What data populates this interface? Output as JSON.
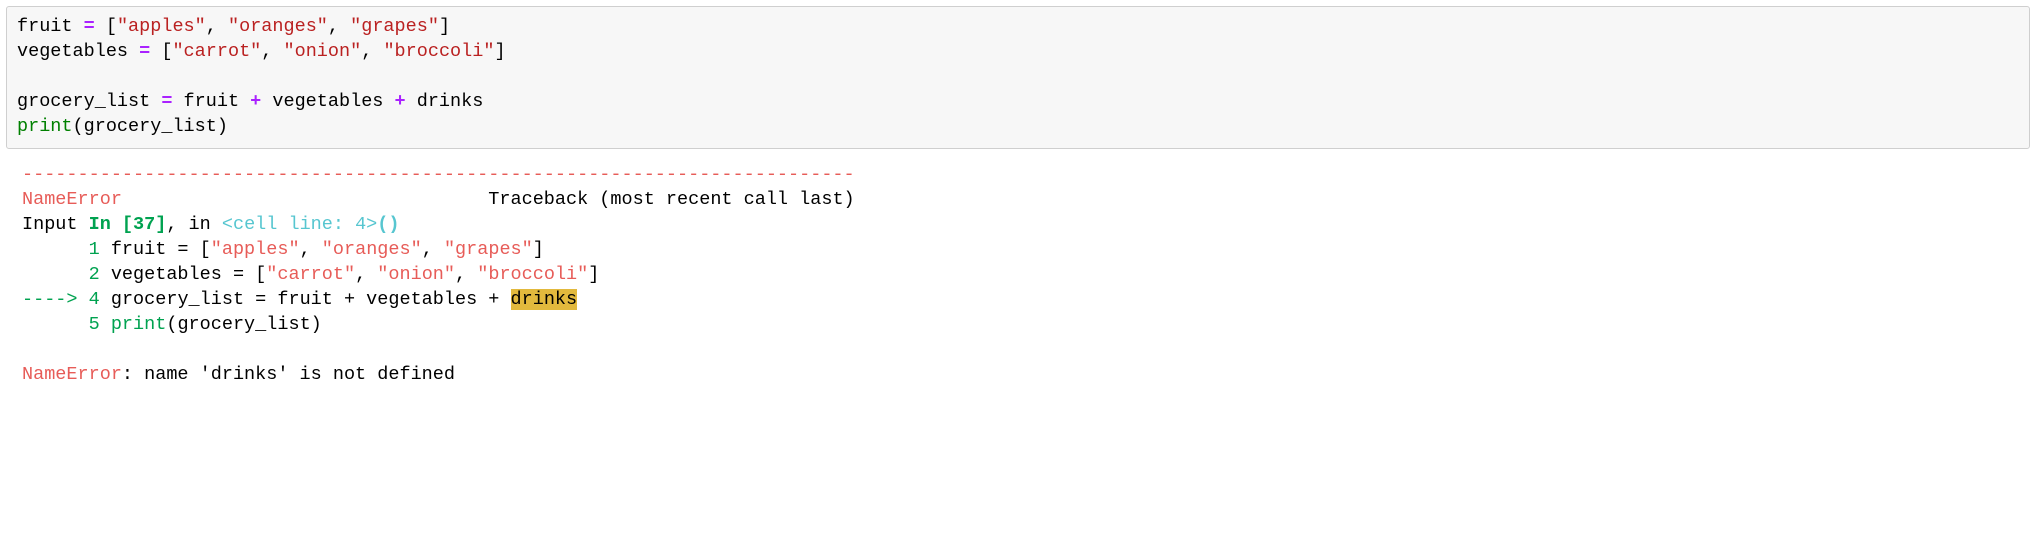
{
  "code": {
    "var_fruit": "fruit",
    "var_vegetables": "vegetables",
    "var_grocery": "grocery_list",
    "var_drinks": "drinks",
    "assign": " = ",
    "plus": " + ",
    "lb": "[",
    "rb": "]",
    "cs": ", ",
    "lp": "(",
    "rp": ")",
    "fruit_items": [
      "\"apples\"",
      "\"oranges\"",
      "\"grapes\""
    ],
    "veg_items": [
      "\"carrot\"",
      "\"onion\"",
      "\"broccoli\""
    ],
    "fn_print": "print"
  },
  "tb": {
    "dashes": "---------------------------------------------------------------------------",
    "errname": "NameError",
    "tb_label": "                                 Traceback (most recent call last)",
    "input_word": "Input ",
    "in_label": "In [37]",
    "comma_in": ", in ",
    "cell_line": "<cell line: 4>",
    "parens": "()",
    "lineno1": "      1",
    "lineno2": "      2",
    "lineno4": "      4",
    "lineno5": "      5",
    "arrow": "----> ",
    "arrow_lineno": "4",
    "line1_pre": " fruit = [",
    "line1_items": [
      "\"apples\"",
      "\"oranges\"",
      "\"grapes\""
    ],
    "line2_pre": " vegetables = [",
    "line2_items": [
      "\"carrot\"",
      "\"onion\"",
      "\"broccoli\""
    ],
    "line4_body": " grocery_list = fruit + vegetables + ",
    "line4_hl": "drinks",
    "line5_sp": " ",
    "line5_print": "print",
    "line5_rest": "(grocery_list)",
    "final_err": "NameError",
    "final_msg": ": name 'drinks' is not defined",
    "cs": ", ",
    "rb": "]"
  }
}
